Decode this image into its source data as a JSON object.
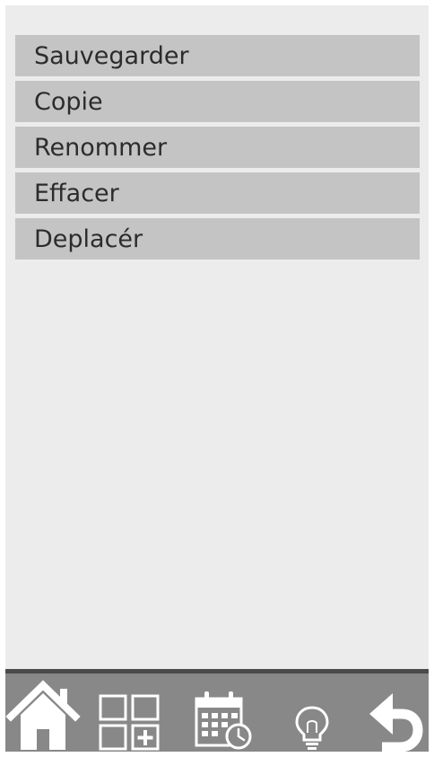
{
  "menu": {
    "items": [
      {
        "label": "Sauvegarder"
      },
      {
        "label": "Copie"
      },
      {
        "label": "Renommer"
      },
      {
        "label": "Effacer"
      },
      {
        "label": "Deplacér"
      }
    ]
  },
  "toolbar": {
    "buttons": [
      {
        "icon": "home-icon"
      },
      {
        "icon": "add-grid-icon"
      },
      {
        "icon": "calendar-clock-icon"
      },
      {
        "icon": "lightbulb-icon"
      },
      {
        "icon": "undo-arrow-icon"
      }
    ]
  },
  "colors": {
    "background": "#ececec",
    "menu_item": "#c4c4c4",
    "toolbar": "#888888",
    "icon": "#ffffff"
  }
}
